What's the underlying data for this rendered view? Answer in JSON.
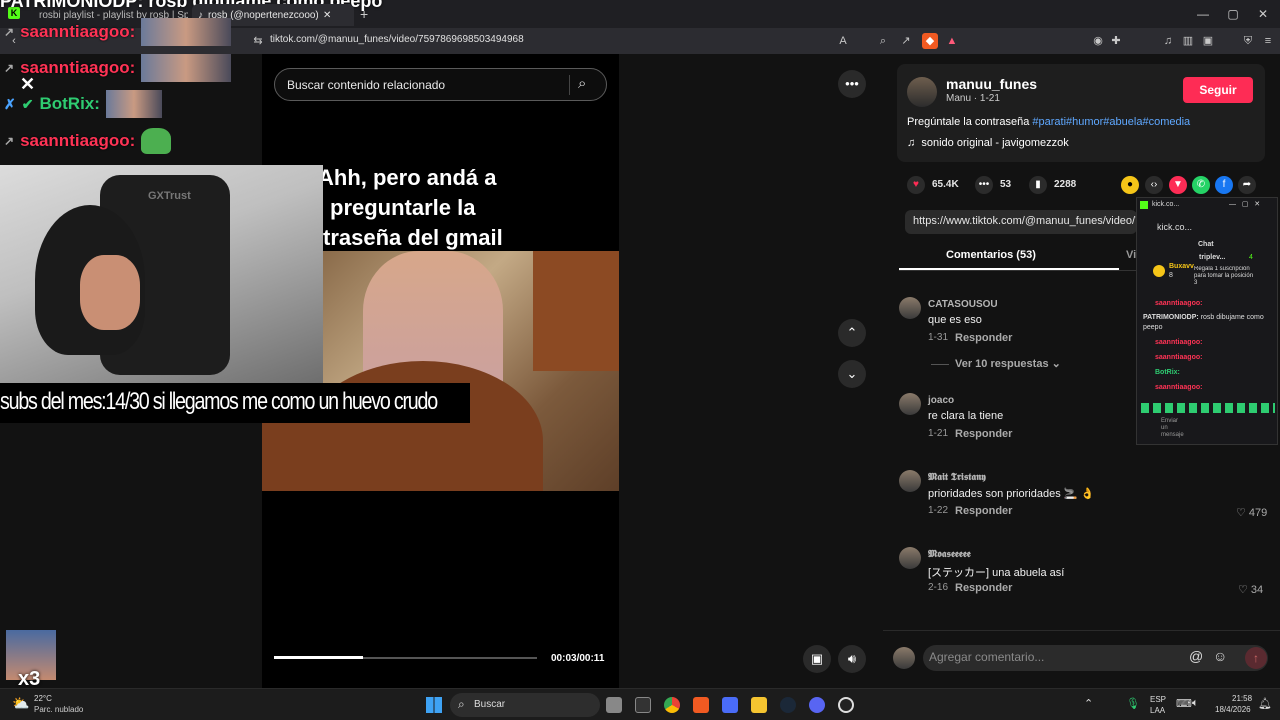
{
  "browser": {
    "tabs": [
      {
        "label": "rosbi playlist - playlist by rosb | Spoti"
      },
      {
        "label": "rosb (@nopertenezcooo) | Tik"
      }
    ],
    "url": "tiktok.com/@manuu_funes/video/7597869698503494968",
    "new_tab": "+",
    "win_min": "—",
    "win_max": "▢",
    "win_close": "✕"
  },
  "stream_overlay": {
    "banner": "PATRIMONIODP: rosb dibujame como peepo",
    "chat": [
      {
        "name": "saanntiaagoo:",
        "emote": "thumb"
      },
      {
        "name": "saanntiaagoo:",
        "emote": "thumb"
      },
      {
        "name": "BotRix:",
        "emote": "thumb"
      },
      {
        "name": "saanntiaagoo:",
        "emote": "pepe"
      }
    ],
    "webcam_brand": "GXTrust",
    "subs_text": "subs del mes:14/30 si llegamos me como un huevo crudo",
    "multiplier": "x3"
  },
  "video": {
    "search_placeholder": "Buscar contenido relacionado",
    "caption_lines": [
      "Ahh, pero  andá a",
      "preguntarle la",
      "traseña del gmail"
    ],
    "current_time": "00:03",
    "duration": "00:11",
    "time_display": "00:03/00:11",
    "progress": 0.34
  },
  "author": {
    "username": "manuu_funes",
    "sub": "Manu · 1-21",
    "follow_label": "Seguir",
    "description": "Pregúntale la contraseña ",
    "hashtags": "#parati#humor#abuela#comedia",
    "sound": "sonido original - javigomezzok"
  },
  "stats": {
    "likes": "65.4K",
    "comments": "53",
    "saves": "2288"
  },
  "share_url": "https://www.tiktok.com/@manuu_funes/video/7",
  "tabs": {
    "comments_label": "Comentarios (53)",
    "videos_label": "Vi"
  },
  "comments": [
    {
      "user": "CATASOUSOU",
      "text": "que es eso",
      "date": "1-31",
      "reply": "Responder",
      "likes": "",
      "more": "Ver 10 respuestas"
    },
    {
      "user": "joaco",
      "text": "re clara la tiene",
      "date": "1-21",
      "reply": "Responder",
      "likes": ""
    },
    {
      "user": "𝕸𝖆𝖎𝖙 𝕿𝖗𝖎𝖘𝖙𝖆𝖓𝖞",
      "text": "prioridades son prioridades 🚬 👌",
      "date": "1-22",
      "reply": "Responder",
      "likes": "479"
    },
    {
      "user": "𝕸𝖔𝖆𝖘𝖊𝖊𝖊𝖊𝖊",
      "text": "[ステッカー] una abuela así",
      "date": "2-16",
      "reply": "Responder",
      "likes": "34"
    }
  ],
  "comment_input_placeholder": "Agregar comentario...",
  "kick_window": {
    "title": "kick.co...",
    "tab": "kick.co...",
    "chat_header": "Chat",
    "sub_user": "triplev...",
    "sub_count": "4",
    "gifter": "Buxavv",
    "gifter_count": "8",
    "sub_text": "Regala 1 suscripción para tomar la posición 3",
    "chat": [
      {
        "name": "saanntiaagoo:",
        "text": ""
      },
      {
        "name": "PATRIMONIODP:",
        "text": "rosb dibujame como peepo"
      },
      {
        "name": "saanntiaagoo:",
        "text": ""
      },
      {
        "name": "saanntiaagoo:",
        "text": ""
      },
      {
        "name": "BotRix:",
        "text": ""
      },
      {
        "name": "saanntiaagoo:",
        "text": ""
      }
    ],
    "send_placeholder": "Enviar un mensaje"
  },
  "taskbar": {
    "weather_temp": "22°C",
    "weather_desc": "Parc. nublado",
    "search_label": "Buscar",
    "lang": "ESP",
    "lang2": "LAA",
    "time": "21:58",
    "date": "18/4/2026"
  },
  "colors": {
    "follow": "#fe2c55",
    "hashtag": "#5fa8ff",
    "chat_name": "#ff3355",
    "botrix": "#2ecc71"
  }
}
